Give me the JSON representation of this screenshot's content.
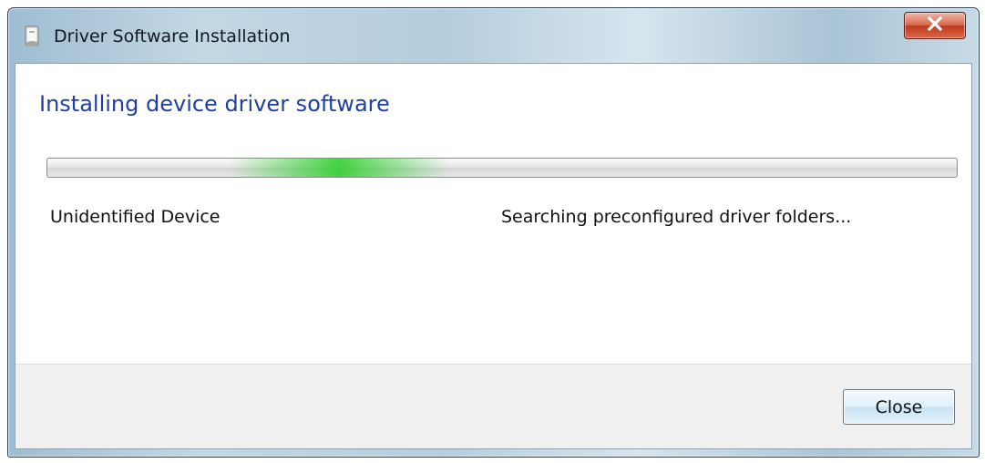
{
  "window": {
    "title": "Driver Software Installation",
    "app_icon": "driver-installation-icon",
    "close_icon": "close-x-icon"
  },
  "main": {
    "heading": "Installing device driver software",
    "device_name": "Unidentified Device",
    "status_text": "Searching preconfigured driver folders...",
    "progress_style": "marquee"
  },
  "footer": {
    "close_label": "Close"
  },
  "colors": {
    "heading": "#1f3fa5",
    "progress_glow": "#26cd26",
    "titlebar_close": "#c0391c"
  }
}
